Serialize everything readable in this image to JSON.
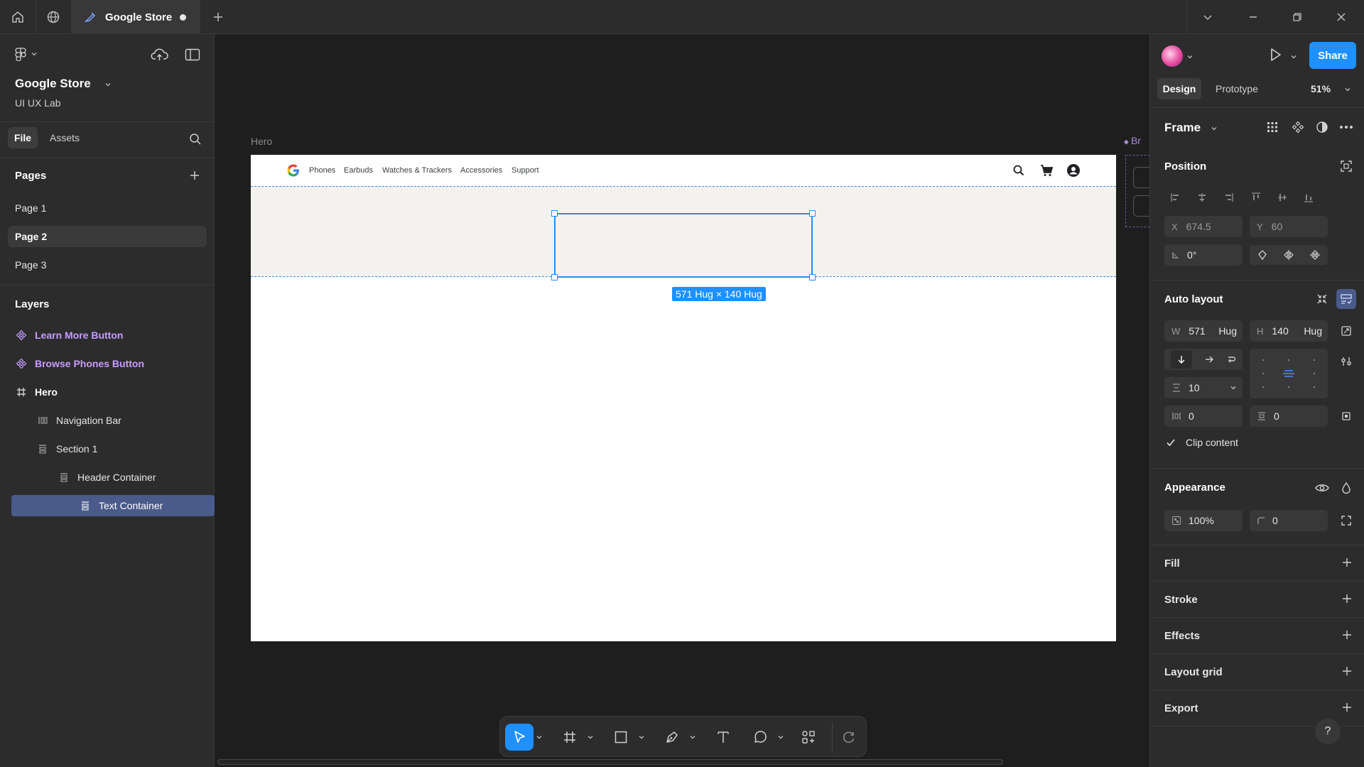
{
  "titlebar": {
    "tab_title": "Google Store"
  },
  "left_panel": {
    "project_name": "Google Store",
    "team_name": "UI UX Lab",
    "tabs": {
      "file": "File",
      "assets": "Assets"
    },
    "pages_heading": "Pages",
    "pages": [
      {
        "label": "Page 1",
        "active": false
      },
      {
        "label": "Page 2",
        "active": true
      },
      {
        "label": "Page 3",
        "active": false
      }
    ],
    "layers_heading": "Layers",
    "layers": [
      {
        "label": "Learn More Button",
        "type": "component",
        "icon": "component-icon"
      },
      {
        "label": "Browse Phones Button",
        "type": "component",
        "icon": "component-icon"
      },
      {
        "label": "Hero",
        "type": "frame",
        "icon": "frame-hash-icon"
      },
      {
        "label": "Navigation Bar",
        "type": "autolayout-horizontal",
        "icon": "autolayout-horizontal-icon"
      },
      {
        "label": "Section 1",
        "type": "autolayout-vertical",
        "icon": "autolayout-vertical-icon"
      },
      {
        "label": "Header Container",
        "type": "autolayout-vertical",
        "icon": "autolayout-vertical-icon"
      },
      {
        "label": "Text Container",
        "type": "autolayout-vertical",
        "icon": "autolayout-vertical-icon",
        "selected": true
      }
    ]
  },
  "canvas": {
    "frame_label": "Hero",
    "peek_label": "Br",
    "nav_links": [
      "Phones",
      "Earbuds",
      "Watches & Trackers",
      "Accessories",
      "Support"
    ],
    "selection_size": "571 Hug × 140 Hug"
  },
  "toolbar": {
    "tools": [
      "move-tool",
      "frame-tool",
      "rectangle-tool",
      "pen-tool",
      "text-tool",
      "comment-tool",
      "actions-tool",
      "dev-mode-toggle"
    ],
    "active_tool": "move-tool"
  },
  "right_panel": {
    "share_label": "Share",
    "modes": {
      "design": "Design",
      "prototype": "Prototype"
    },
    "zoom": "51%",
    "selection_type": "Frame",
    "position": {
      "heading": "Position",
      "x_label": "X",
      "x_value": "674.5",
      "y_label": "Y",
      "y_value": "60",
      "rotation": "0°"
    },
    "auto_layout": {
      "heading": "Auto layout",
      "w_label": "W",
      "w_value": "571",
      "w_mode": "Hug",
      "h_label": "H",
      "h_value": "140",
      "h_mode": "Hug",
      "gap": "10",
      "padding_h": "0",
      "padding_v": "0",
      "clip_content": "Clip content",
      "clip_checked": true
    },
    "appearance": {
      "heading": "Appearance",
      "opacity": "100%",
      "radius": "0"
    },
    "collapsed_sections": [
      "Fill",
      "Stroke",
      "Effects",
      "Layout grid",
      "Export"
    ],
    "help": "?"
  },
  "colors": {
    "accent": "#1e90ff",
    "panel_bg": "#2c2c2c",
    "canvas_bg": "#1e1e1e",
    "component_purple": "#c79cff",
    "selected_layer": "#4a5a8a"
  }
}
